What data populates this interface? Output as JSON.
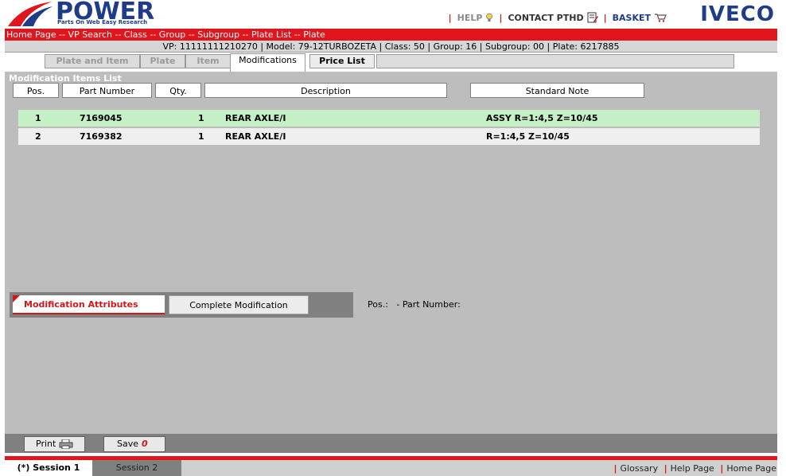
{
  "header": {
    "logo_text": "POWER",
    "logo_tagline": "Parts On Web Easy Research",
    "help": "HELP",
    "contact": "CONTACT PTHD",
    "basket": "BASKET",
    "brand": "IVECO"
  },
  "breadcrumb": "Home Page -- VP Search -- Class -- Group -- Subgroup -- Plate List -- Plate",
  "infobar": "VP: 11111111210270 | Model: 79-12TURBOZETA | Class: 50 | Group: 16 | Subgroup: 00 | Plate: 6217885",
  "tabs": [
    "Plate and Item",
    "Plate",
    "Item",
    "Modifications",
    "Price List"
  ],
  "list": {
    "title": "Modification Items List",
    "columns": [
      "Pos.",
      "Part Number",
      "Qty.",
      "Description",
      "Standard Note"
    ],
    "rows": [
      {
        "pos": "1",
        "part_number": "7169045",
        "qty": "1",
        "description": "REAR AXLE/I",
        "note": "ASSY R=1:4,5 Z=10/45"
      },
      {
        "pos": "2",
        "part_number": "7169382",
        "qty": "1",
        "description": "REAR AXLE/I",
        "note": "R=1:4,5 Z=10/45"
      }
    ]
  },
  "attributes": {
    "tab_active": "Modification Attributes",
    "tab_other": "Complete Modification",
    "pos_info": "Pos.:   - Part Number:"
  },
  "actions": {
    "print": "Print",
    "save": "Save",
    "save_count": "0"
  },
  "footer": {
    "session1": "(*) Session 1",
    "session2": "Session 2",
    "glossary": "Glossary",
    "help_page": "Help Page",
    "home_page": "Home Page"
  },
  "colors": {
    "accent_red": "#e0161c",
    "brand_blue": "#1f3c88",
    "selected_row": "#c5efc5"
  }
}
